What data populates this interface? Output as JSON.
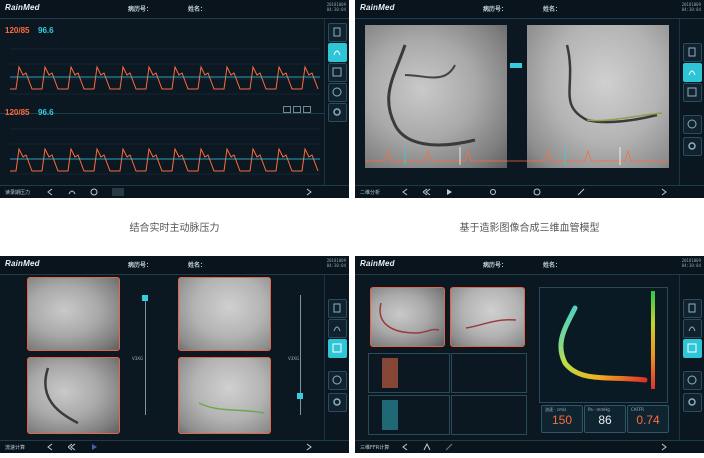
{
  "brand": "RainMed",
  "header": {
    "record_label": "病历号：",
    "name_label": "姓名："
  },
  "timestamp": {
    "date": "20181009",
    "time": "04:30:04"
  },
  "colors": {
    "accent": "#2ec6d7",
    "pressure_red": "#ff6a3d",
    "pressure_cyan": "#36cde0",
    "box": "#e4664a"
  },
  "panel1": {
    "pressure_a": "120/85",
    "mean_a": "96.6",
    "pressure_b": "120/85",
    "mean_b": "96.6",
    "footer": "读录期压力"
  },
  "panel2": {
    "footer": "二维分析"
  },
  "panel3": {
    "footer": "流速计算",
    "vessel_label_1": "V3XG",
    "vessel_label_2": "V3XG"
  },
  "panel4": {
    "footer": "三维FFR计算",
    "metrics": [
      {
        "label": "流速 · cm/s",
        "value": "150",
        "color": "#ff6a3d"
      },
      {
        "label": "Pa · mmHg",
        "value": "86",
        "color": "#e6eef2"
      },
      {
        "label": "CAFFR",
        "value": "0.74",
        "color": "#ff6a3d"
      }
    ]
  },
  "captions": {
    "c1": "结合实时主动脉压力",
    "c2": "基于造影图像合成三维血管模型"
  },
  "sidebar_icons": [
    "document-icon",
    "pressure-icon",
    "report-icon",
    "clock-icon",
    "settings-icon"
  ]
}
